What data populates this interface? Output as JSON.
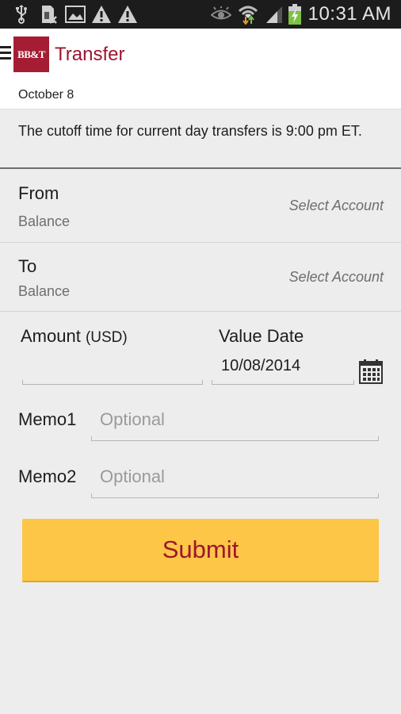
{
  "status_bar": {
    "left_icons": [
      "usb-icon",
      "sim-card-x-icon",
      "gallery-icon",
      "warning-icon",
      "warning-icon"
    ],
    "right_icons": [
      "eye-icon",
      "wifi-icon",
      "signal-icon",
      "battery-charging-icon"
    ],
    "time": "10:31 AM"
  },
  "app_bar": {
    "logo_text": "BB&T",
    "title": "Transfer",
    "brand_color": "#9b1631"
  },
  "date_header": "October 8",
  "notice": "The cutoff time for current day transfers is 9:00 pm ET.",
  "from": {
    "label": "From",
    "balance_label": "Balance",
    "select_placeholder": "Select Account"
  },
  "to": {
    "label": "To",
    "balance_label": "Balance",
    "select_placeholder": "Select Account"
  },
  "amount": {
    "label": "Amount",
    "currency": "(USD)",
    "value": ""
  },
  "value_date": {
    "label": "Value Date",
    "value": "10/08/2014"
  },
  "memo1": {
    "label": "Memo1",
    "placeholder": "Optional"
  },
  "memo2": {
    "label": "Memo2",
    "placeholder": "Optional"
  },
  "submit": {
    "label": "Submit",
    "color": "#fdc646"
  }
}
